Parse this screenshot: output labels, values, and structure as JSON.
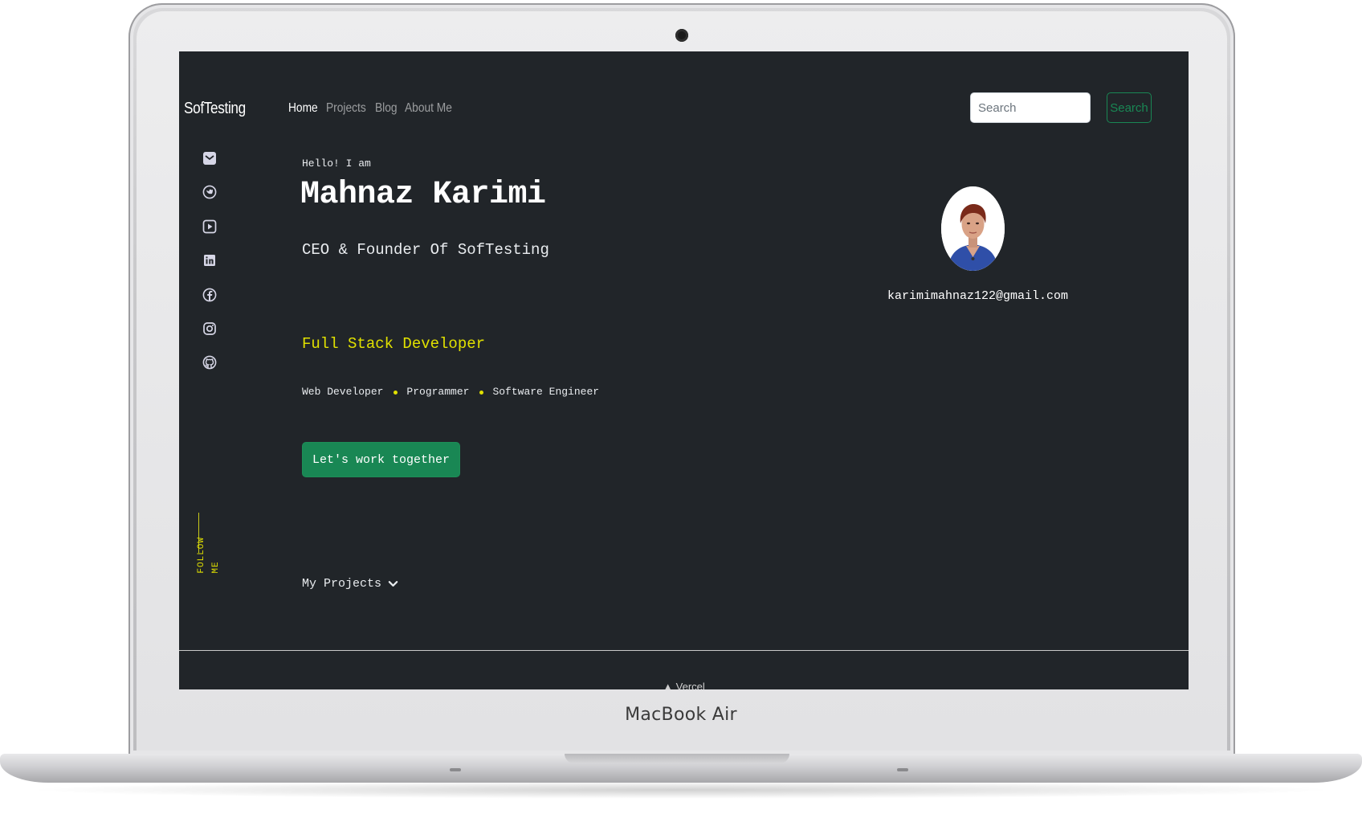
{
  "device": {
    "label": "MacBook Air"
  },
  "nav": {
    "brand": "SofTesting",
    "links": [
      "Home",
      "Projects",
      "Blog",
      "About Me"
    ],
    "active": "Home",
    "search_placeholder": "Search",
    "search_button": "Search"
  },
  "social": {
    "icons": [
      "mail-icon",
      "twitter-icon",
      "youtube-icon",
      "linkedin-icon",
      "facebook-icon",
      "instagram-icon",
      "github-icon"
    ],
    "follow_label": "FOLLOW ME"
  },
  "hero": {
    "greeting": "Hello! I am",
    "name": "Mahnaz Karimi",
    "title": "CEO & Founder Of SofTesting",
    "highlight": "Full Stack Developer",
    "skills": [
      "Web Developer",
      "Programmer",
      "Software Engineer"
    ],
    "cta_label": "Let's work together",
    "projects_link": "My Projects"
  },
  "profile": {
    "email": "karimimahnaz122@gmail.com"
  },
  "footer": {
    "text": "▲ Vercel"
  },
  "colors": {
    "background": "#212529",
    "accent_yellow": "#e1e100",
    "success_green": "#198754"
  }
}
